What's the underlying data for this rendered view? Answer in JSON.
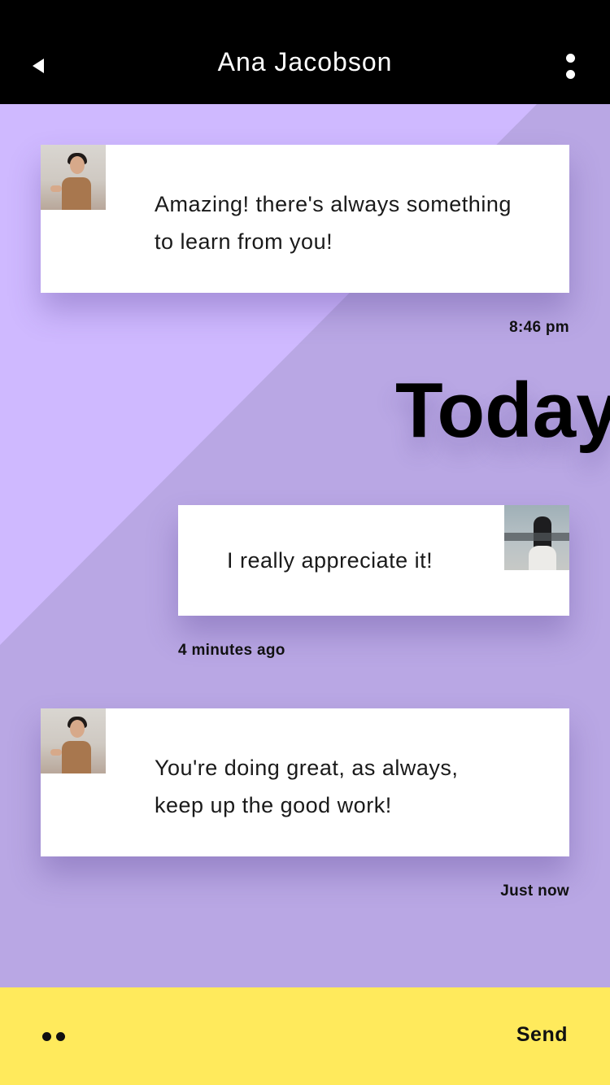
{
  "header": {
    "title": "Ana Jacobson",
    "back_icon": "back-arrow-icon",
    "more_icon": "more-vertical-icon"
  },
  "messages": [
    {
      "text": "Amazing! there's always something to learn from you!",
      "time": "8:46 pm",
      "sender": "contact"
    },
    {
      "text": "I really appreciate it!",
      "time": "4 minutes ago",
      "sender": "me"
    },
    {
      "text": "You're doing great, as always, keep up the good work!",
      "time": "Just now",
      "sender": "contact"
    }
  ],
  "divider": {
    "label": "Today"
  },
  "footer": {
    "emoji_icon": "emoji-dots-icon",
    "send_label": "Send"
  },
  "colors": {
    "header_bg": "#000000",
    "background": "#b9a7e4",
    "background_light": "#cfb9ff",
    "footer_bg": "#ffea5c"
  }
}
